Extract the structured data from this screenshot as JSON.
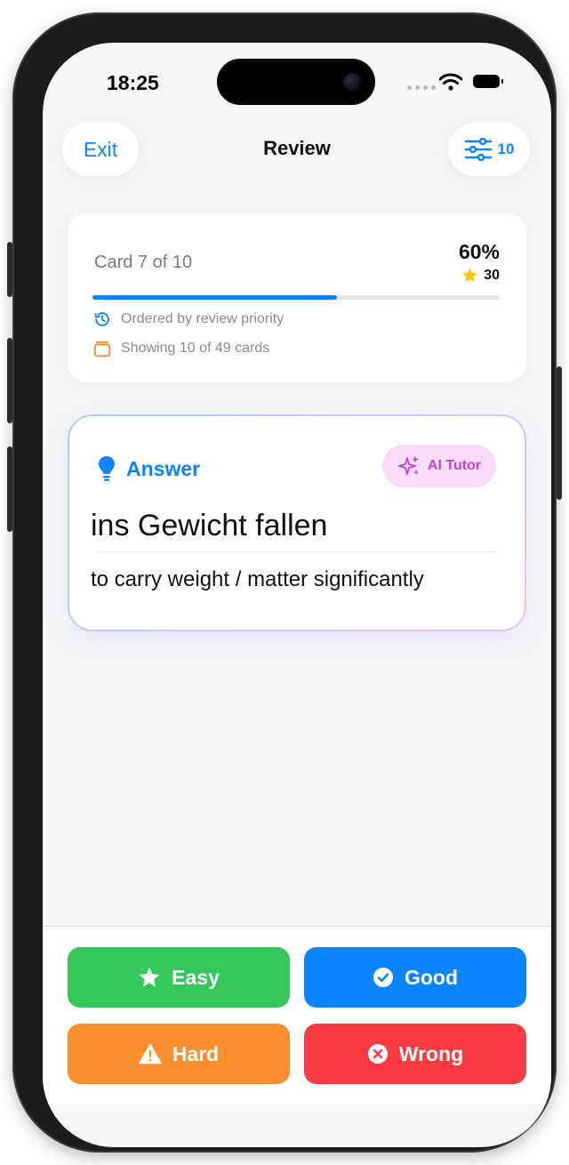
{
  "status_bar": {
    "time": "18:25"
  },
  "nav": {
    "exit_label": "Exit",
    "title": "Review",
    "filter_count": "10"
  },
  "progress": {
    "card_label": "Card 7 of 10",
    "percent_label": "60%",
    "stars": "30",
    "fraction": 0.6,
    "order_text": "Ordered by review priority",
    "showing_text": "Showing 10 of 49 cards"
  },
  "card": {
    "side_label": "Answer",
    "ai_tutor_label": "AI Tutor",
    "term": "ins Gewicht fallen",
    "meaning": "to carry weight / matter significantly"
  },
  "grades": [
    {
      "label": "Easy",
      "color": "#34c759",
      "icon": "star-icon"
    },
    {
      "label": "Good",
      "color": "#0a84ff",
      "icon": "check-circle-icon"
    },
    {
      "label": "Hard",
      "color": "#fa8e2c",
      "icon": "warning-icon"
    },
    {
      "label": "Wrong",
      "color": "#fa3c42",
      "icon": "x-circle-icon"
    }
  ],
  "colors": {
    "accent": "#0a84ff",
    "ai": "#c244d2",
    "star": "#fec30a"
  }
}
